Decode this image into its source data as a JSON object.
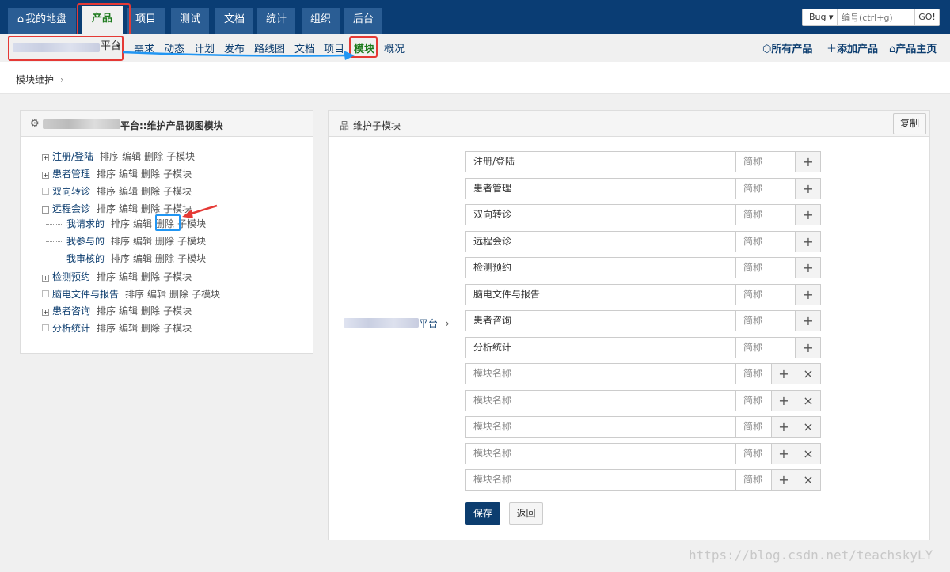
{
  "topnav": {
    "tabs": [
      {
        "label": "我的地盘",
        "icon": "home-icon"
      },
      {
        "label": "产品"
      },
      {
        "label": "项目"
      },
      {
        "label": "测试"
      },
      {
        "label": "文档"
      },
      {
        "label": "统计"
      },
      {
        "label": "组织"
      },
      {
        "label": "后台"
      }
    ],
    "search": {
      "type": "Bug",
      "placeholder": "编号(ctrl+g)",
      "go": "GO!"
    }
  },
  "subnav": {
    "product_suffix": "平台",
    "links": [
      "需求",
      "动态",
      "计划",
      "发布",
      "路线图",
      "文档",
      "项目",
      "模块",
      "概况"
    ],
    "right": [
      {
        "label": "所有产品",
        "icon": "cube-icon"
      },
      {
        "label": "添加产品",
        "icon": "plus-icon"
      },
      {
        "label": "产品主页",
        "icon": "home-icon"
      }
    ]
  },
  "breadcrumb": {
    "label": "模块维护",
    "sep": "›"
  },
  "left_panel": {
    "title": "平台::维护产品视图模块",
    "actions": [
      "排序",
      "编辑",
      "删除",
      "子模块"
    ],
    "modules": [
      {
        "name": "注册/登陆",
        "expand": "+"
      },
      {
        "name": "患者管理",
        "expand": "+"
      },
      {
        "name": "双向转诊",
        "expand": ""
      },
      {
        "name": "远程会诊",
        "expand": "−"
      },
      {
        "name": "我请求的",
        "child": true
      },
      {
        "name": "我参与的",
        "child": true
      },
      {
        "name": "我审核的",
        "child": true
      },
      {
        "name": "检测预约",
        "expand": "+"
      },
      {
        "name": "脑电文件与报告",
        "expand": ""
      },
      {
        "name": "患者咨询",
        "expand": "+"
      },
      {
        "name": "分析统计",
        "expand": ""
      }
    ]
  },
  "right_panel": {
    "title": "维护子模块",
    "copy": "复制",
    "parent_suffix": "平台",
    "parent_sep": "›",
    "short_placeholder": "简称",
    "name_placeholder": "模块名称",
    "existing": [
      "注册/登陆",
      "患者管理",
      "双向转诊",
      "远程会诊",
      "检测预约",
      "脑电文件与报告",
      "患者咨询",
      "分析统计"
    ],
    "empty_rows": 5,
    "save": "保存",
    "back": "返回"
  },
  "watermark": "https://blog.csdn.net/teachskyLY"
}
